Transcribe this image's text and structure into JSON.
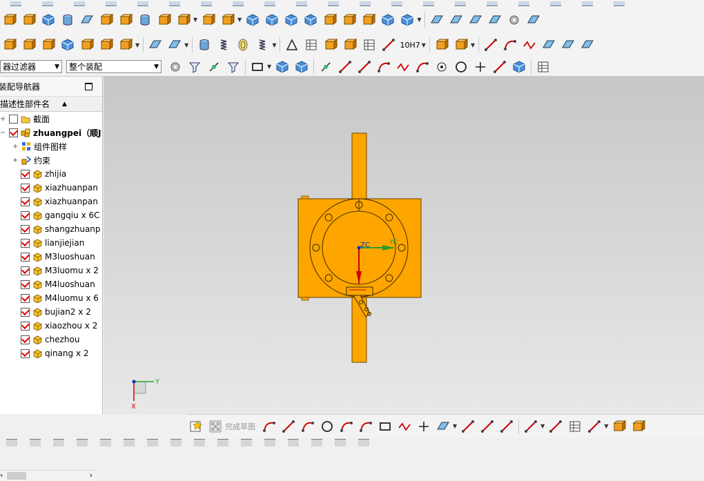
{
  "toolbar": {
    "filter_combo": "器过滤器",
    "assembly_combo": "整个装配",
    "finish_sketch_label": "完成草图",
    "fit_label": "10H7"
  },
  "navigator": {
    "title": "装配导航器",
    "column_header": "描述性部件名",
    "items": [
      {
        "label": "截面",
        "checked": false,
        "icon": "folder-icon",
        "indent": 1
      },
      {
        "label": "zhuangpei（顺J",
        "checked": true,
        "icon": "assembly-icon",
        "indent": 1,
        "bold": true
      },
      {
        "label": "组件图样",
        "checked": null,
        "icon": "component-pattern-icon",
        "indent": 2
      },
      {
        "label": "约束",
        "checked": null,
        "icon": "constraints-icon",
        "indent": 2
      },
      {
        "label": "zhijia",
        "checked": true,
        "icon": "part-icon",
        "indent": 3
      },
      {
        "label": "xiazhuanpan",
        "checked": true,
        "icon": "part-icon",
        "indent": 3
      },
      {
        "label": "xiazhuanpan",
        "checked": true,
        "icon": "part-icon",
        "indent": 3
      },
      {
        "label": "gangqiu x 6C",
        "checked": true,
        "icon": "part-icon",
        "indent": 3
      },
      {
        "label": "shangzhuanp",
        "checked": true,
        "icon": "part-icon",
        "indent": 3
      },
      {
        "label": "lianjiejian",
        "checked": true,
        "icon": "part-icon",
        "indent": 3
      },
      {
        "label": "M3luoshuan",
        "checked": true,
        "icon": "part-icon",
        "indent": 3
      },
      {
        "label": "M3luomu x 2",
        "checked": true,
        "icon": "part-icon",
        "indent": 3
      },
      {
        "label": "M4luoshuan",
        "checked": true,
        "icon": "part-icon",
        "indent": 3
      },
      {
        "label": "M4luomu x 6",
        "checked": true,
        "icon": "part-icon",
        "indent": 3
      },
      {
        "label": "bujian2 x 2",
        "checked": true,
        "icon": "part-icon",
        "indent": 3
      },
      {
        "label": "xiaozhou x 2",
        "checked": true,
        "icon": "part-icon",
        "indent": 3
      },
      {
        "label": "chezhou",
        "checked": true,
        "icon": "part-icon",
        "indent": 3
      },
      {
        "label": "qinang x 2",
        "checked": true,
        "icon": "part-icon",
        "indent": 3
      }
    ]
  },
  "viewport": {
    "axis_zc": "ZC",
    "axis_yc": "YC",
    "triad_y": "Y",
    "triad_x": "X",
    "model_color": "#ffa500"
  }
}
